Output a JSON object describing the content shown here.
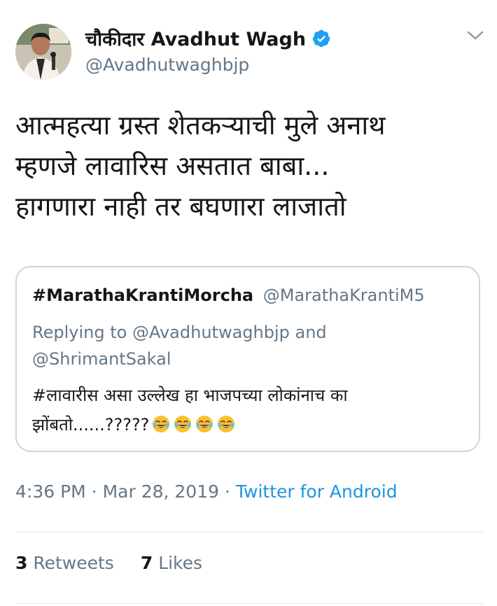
{
  "author": {
    "name": "चौकीदार Avadhut Wagh",
    "handle": "@Avadhutwaghbjp",
    "verified": true,
    "avatar_icon": "profile-photo"
  },
  "tweet": {
    "lines": [
      "आत्महत्या ग्रस्त शेतकऱ्याची मुले अनाथ",
      "म्हणजे लावारिस असतात बाबा...",
      "हागणारा नाही तर बघणारा लाजातो"
    ]
  },
  "quoted_tweet": {
    "author_name": "#MarathaKrantiMorcha",
    "author_handle": "@MarathaKrantiM5",
    "replying_prefix": "Replying to",
    "replying_user1": "@Avadhutwaghbjp",
    "replying_and": "and",
    "replying_user2": "@ShrimantSakal",
    "text_line1": "#लावारीस असा उल्लेख हा भाजपच्या लोकांनाच का",
    "text_line2": "झोंबतो......?????",
    "emoji_count": 4,
    "emoji_name": "face-with-tears-of-joy"
  },
  "meta": {
    "time": "4:36 PM",
    "sep1": " · ",
    "date": "Mar 28, 2019",
    "sep2": " · ",
    "source": "Twitter for Android"
  },
  "stats": {
    "retweets_count": "3",
    "retweets_label": "Retweets",
    "likes_count": "7",
    "likes_label": "Likes"
  },
  "colors": {
    "link_blue": "#1b95e0",
    "verified_blue": "#1da1f2",
    "secondary_text": "#657786",
    "border": "#ccd6dd"
  }
}
